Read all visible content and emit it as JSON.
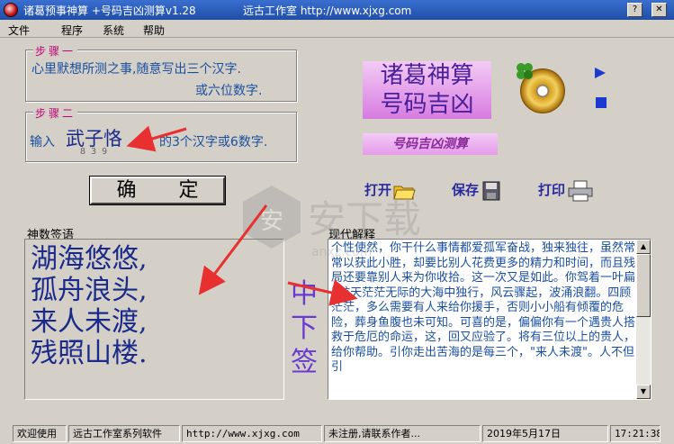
{
  "window": {
    "title": "诸葛预事神算 +号码吉凶测算v1.28",
    "publisher": "远古工作室 http://www.xjxg.com"
  },
  "menu": [
    "文件",
    "程序",
    "系统",
    "帮助"
  ],
  "step1": {
    "legend": "步骤一",
    "line1": "心里默想所测之事,随意写出三个汉字.",
    "line2": "或六位数字."
  },
  "step2": {
    "legend": "步骤二",
    "prefix": "输入",
    "input_value": "武子恪",
    "suffix_a": "则",
    "suffix_b": "的3个汉字或6数字.",
    "digits": "8 3 9"
  },
  "confirm_label": "确 定",
  "poem": {
    "label": "神数签语",
    "lines": [
      "湖海悠悠,",
      "孤舟浪头,",
      "来人未渡,",
      "残照山楼."
    ]
  },
  "verdict": "中下签",
  "explain": {
    "label": "现代解释",
    "text": "个性使然，你干什么事情都爱孤军奋战，独来独往，虽然常常以获此小胜，却要比别人花费更多的精力和时间，而且残局还要靠别人来为你收拾。这一次又是如此。你驾着一叶扁3航天茫茫无际的大海中独行，风云骤起，波涌浪翻。四顾茫茫，多么需要有人来给你援手，否则小小船有倾覆的危险，葬身鱼腹也未可知。可喜的是，偏偏你有一个遇贵人搭救于危厄的命运，这，回又应验了。将有三位以上的贵人，给你帮助。引你走出苦海的是每三个，\"来人未渡\"。人不但引"
  },
  "logo": {
    "title_line1": "诸葛神算",
    "title_line2": "号码吉凶",
    "subtitle": "号码吉凶测算"
  },
  "toolbar": {
    "open": "打开",
    "save": "保存",
    "print": "打印"
  },
  "statusbar": {
    "welcome": "欢迎使用",
    "series": "远古工作室系列软件",
    "url": "http://www.xjxg.com",
    "reg": "未注册,请联系作者...",
    "date": "2019年5月17日",
    "time": "17:21:38"
  }
}
